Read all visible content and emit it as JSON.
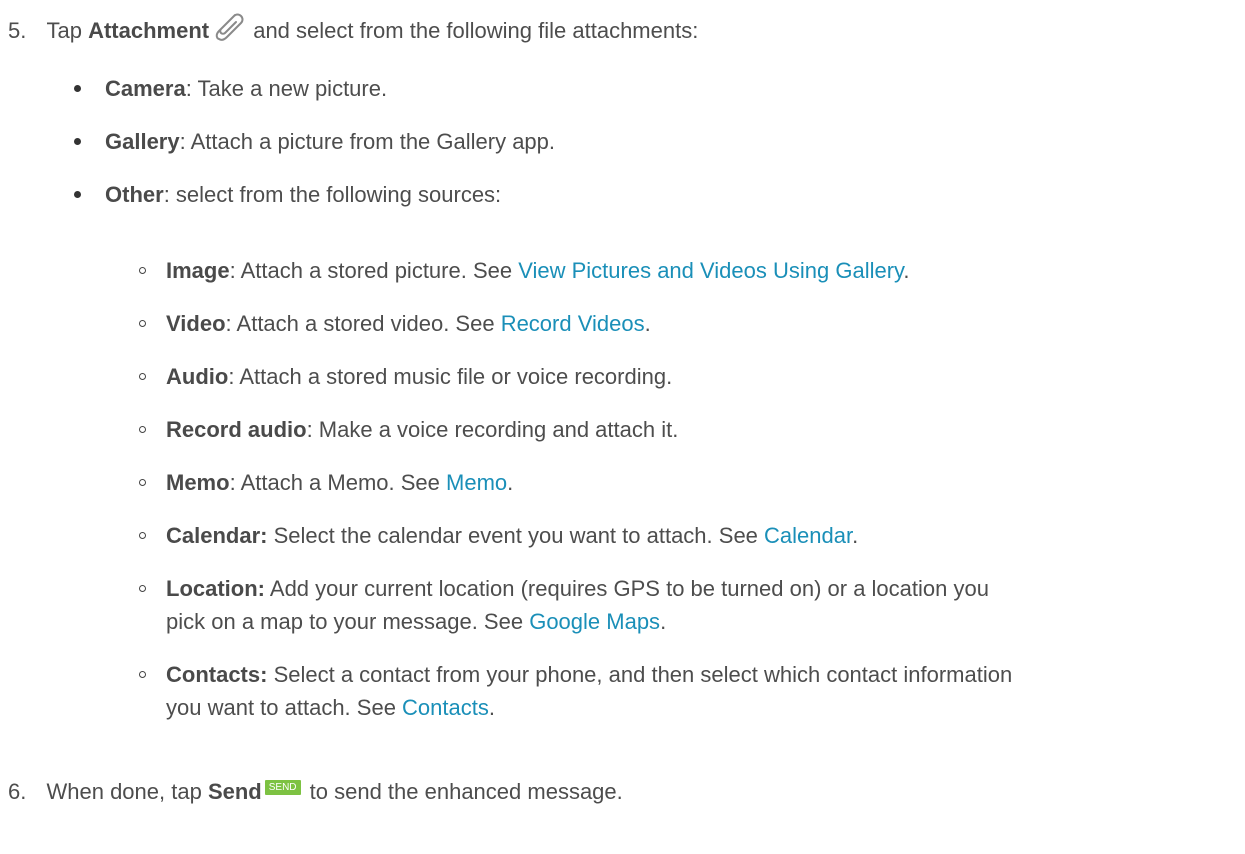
{
  "step5": {
    "number": "5.",
    "pre": "Tap ",
    "bold": "Attachment",
    "icon": "paperclip-icon",
    "post": " and select from the following file attachments:"
  },
  "bullets": [
    {
      "bold": "Camera",
      "text": ": Take a new picture."
    },
    {
      "bold": "Gallery",
      "text": ": Attach a picture from the Gallery app."
    },
    {
      "bold": "Other",
      "text": ": select from the following sources:"
    }
  ],
  "sub": [
    {
      "bold": "Image",
      "text": ": Attach a stored picture. See ",
      "link": "View Pictures and Videos Using Gallery",
      "end": "."
    },
    {
      "bold": "Video",
      "text": ": Attach a stored video. See ",
      "link": "Record Videos",
      "end": "."
    },
    {
      "bold": "Audio",
      "text": ": Attach a stored music file or voice recording."
    },
    {
      "bold": "Record audio",
      "text": ": Make a voice recording and attach it."
    },
    {
      "bold": "Memo",
      "text": ": Attach a Memo. See ",
      "link": "Memo",
      "end": "."
    },
    {
      "bold": "Calendar:",
      "text": " Select the calendar event you want to attach. See ",
      "link": "Calendar",
      "end": "."
    },
    {
      "bold": "Location:",
      "text": " Add your current location (requires GPS to be turned on) or a location you",
      "line2": "pick on a map to your message. See ",
      "link": "Google Maps",
      "end": "."
    },
    {
      "bold": "Contacts:",
      "text": " Select a contact from your phone, and then select which contact information",
      "line2": "you want to attach. See ",
      "link": "Contacts",
      "end": "."
    }
  ],
  "step6": {
    "number": "6.",
    "pre": "When done, tap ",
    "bold": "Send",
    "button_label": "SEND",
    "button_color": "#7dc242",
    "post": " to send the enhanced message."
  },
  "colors": {
    "text": "#4d4d4d",
    "link": "#1a8fb8"
  }
}
